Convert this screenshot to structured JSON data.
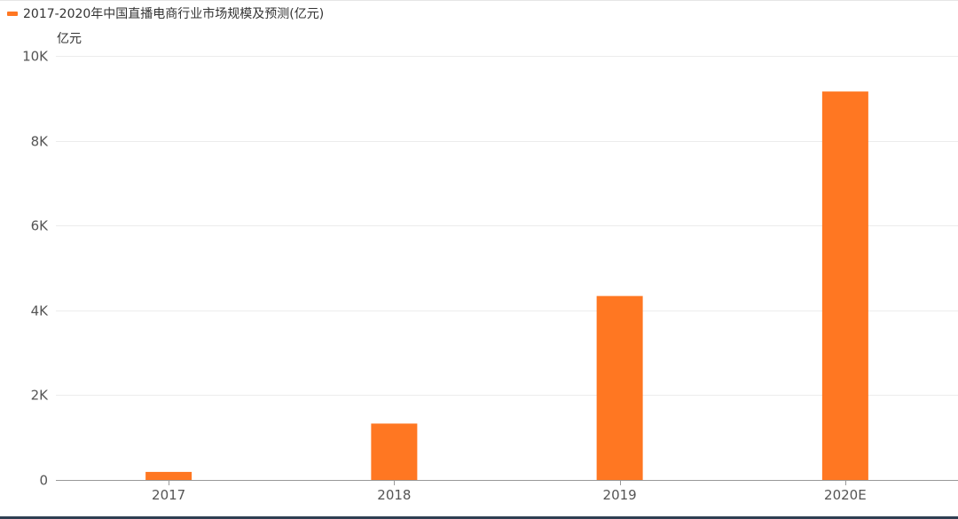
{
  "chart_data": {
    "type": "bar",
    "legend_position": "top-left",
    "grid": true,
    "categories": [
      "2017",
      "2018",
      "2019",
      "2020E"
    ],
    "series": [
      {
        "name": "2017-2020年中国直播电商行业市场规模及预测(亿元)",
        "values": [
          190,
          1330,
          4338,
          9160
        ],
        "color": "#ff7722"
      }
    ],
    "ylabel": "亿元",
    "ylim": [
      0,
      10000
    ],
    "yticks": [
      {
        "value": 0,
        "label": "0"
      },
      {
        "value": 2000,
        "label": "2K"
      },
      {
        "value": 4000,
        "label": "4K"
      },
      {
        "value": 6000,
        "label": "6K"
      },
      {
        "value": 8000,
        "label": "8K"
      },
      {
        "value": 10000,
        "label": "10K"
      }
    ],
    "colors": {
      "grid": "#ececec",
      "axis": "#999999",
      "tick_text": "#555555"
    }
  }
}
